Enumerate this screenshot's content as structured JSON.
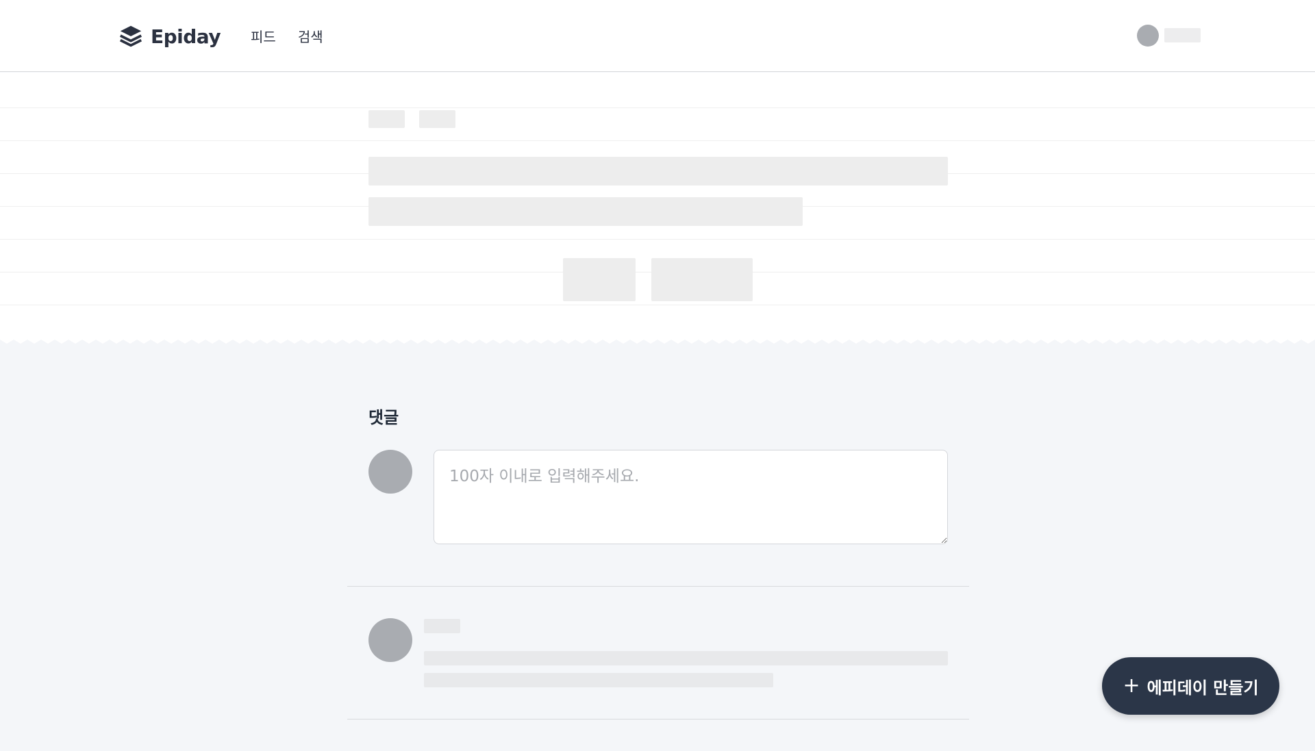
{
  "header": {
    "logo_text": "Epiday",
    "nav": [
      {
        "label": "피드"
      },
      {
        "label": "검색"
      }
    ]
  },
  "comments": {
    "title": "댓글",
    "input_placeholder": "100자 이내로 입력해주세요."
  },
  "fab": {
    "icon": "plus-icon",
    "label": "에피데이 만들기"
  },
  "colors": {
    "header_bg": "#ffffff",
    "page_bg": "#f4f6f9",
    "skeleton": "#ededed",
    "avatar_placeholder": "#a9acb1",
    "fab_bg": "#2b3648",
    "text_primary": "#2b3140"
  }
}
